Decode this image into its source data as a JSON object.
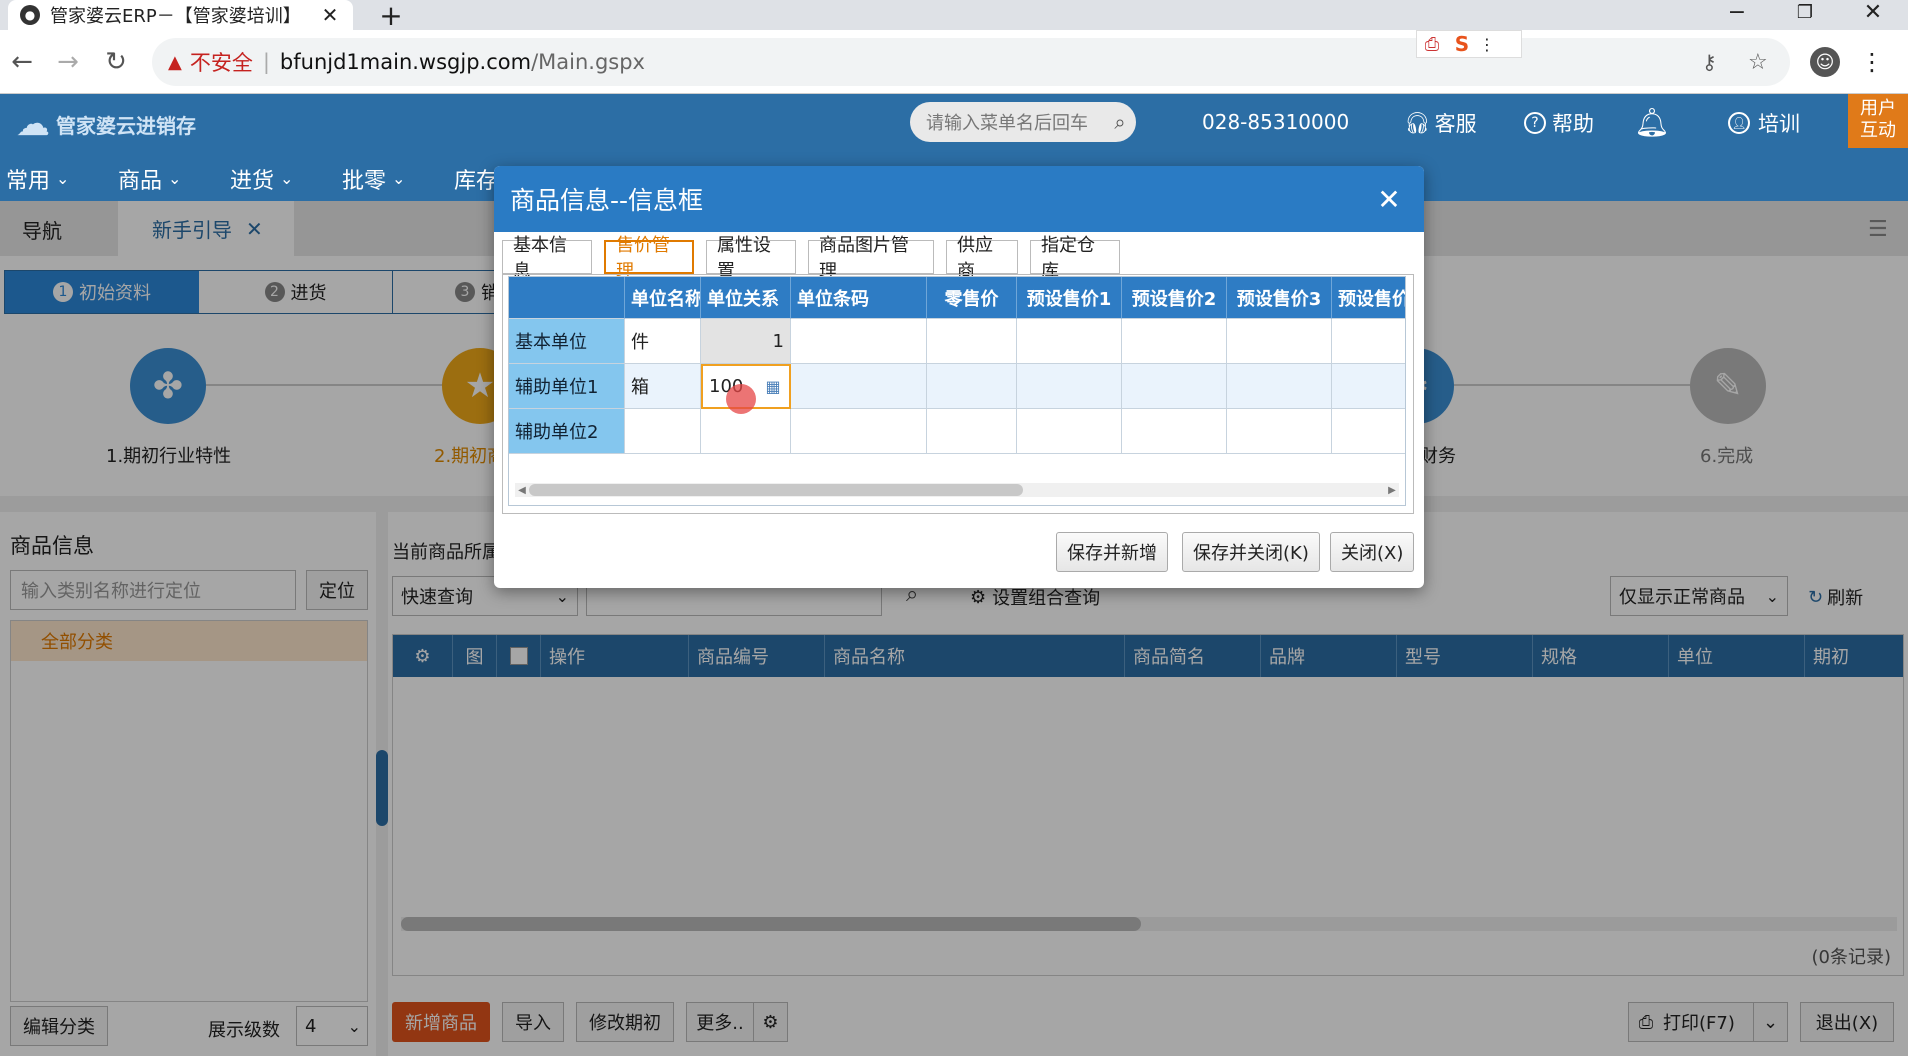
{
  "browser": {
    "tab_title": "管家婆云ERP－【管家婆培训】",
    "security_label": "不安全",
    "url_domain": "bfunjd1main.wsgjp.com",
    "url_path": "/Main.gspx"
  },
  "app": {
    "logo_text": "管家婆云进销存",
    "search_placeholder": "请输入菜单名后回车",
    "phone": "028-85310000",
    "service_label": "客服",
    "help_label": "帮助",
    "user_label": "培训",
    "interact_label_1": "用户",
    "interact_label_2": "互动",
    "menu": [
      "常用",
      "商品",
      "进货",
      "批零",
      "库存"
    ]
  },
  "nav": {
    "tab_nav": "导航",
    "tab_guide": "新手引导"
  },
  "steps": {
    "bar": [
      {
        "num": "1",
        "label": "初始资料"
      },
      {
        "num": "2",
        "label": "进货"
      },
      {
        "num": "3",
        "label": "销"
      }
    ],
    "circles": [
      {
        "label": "1.期初行业特性"
      },
      {
        "label": "2.期初商"
      },
      {
        "label": "财务"
      },
      {
        "label": "6.完成"
      }
    ]
  },
  "left_panel": {
    "title": "商品信息",
    "search_placeholder": "输入类别名称进行定位",
    "locate_button": "定位",
    "all_category": "全部分类",
    "edit_button": "编辑分类",
    "level_label": "展示级数",
    "level_value": "4"
  },
  "main_panel": {
    "current_label": "当前商品所属",
    "quick_query": "快速查询",
    "combo_query": "设置组合查询",
    "filter_select": "仅显示正常商品",
    "refresh": "刷新",
    "columns": [
      "图",
      "操作",
      "商品编号",
      "商品名称",
      "商品简名",
      "品牌",
      "型号",
      "规格",
      "单位",
      "期初"
    ],
    "record_count": "(0条记录)",
    "buttons": {
      "add": "新增商品",
      "import": "导入",
      "modify": "修改期初",
      "more": "更多..",
      "print": "打印(F7)",
      "exit": "退出(X)"
    }
  },
  "dialog": {
    "title": "商品信息--信息框",
    "tabs": [
      "基本信息",
      "售价管理",
      "属性设置",
      "商品图片管理",
      "供应商",
      "指定仓库"
    ],
    "active_tab": "售价管理",
    "columns": [
      "单位名称",
      "单位关系",
      "单位条码",
      "零售价",
      "预设售价1",
      "预设售价2",
      "预设售价3",
      "预设售价"
    ],
    "rows": [
      {
        "head": "基本单位",
        "name": "件",
        "relation": "1"
      },
      {
        "head": "辅助单位1",
        "name": "箱",
        "relation": "100"
      },
      {
        "head": "辅助单位2",
        "name": "",
        "relation": ""
      }
    ],
    "buttons": {
      "save_new": "保存并新增",
      "save_close": "保存并关闭(K)",
      "close": "关闭(X)"
    },
    "accent_color": "#2a7bc4",
    "active_tab_color": "#e07a00"
  }
}
